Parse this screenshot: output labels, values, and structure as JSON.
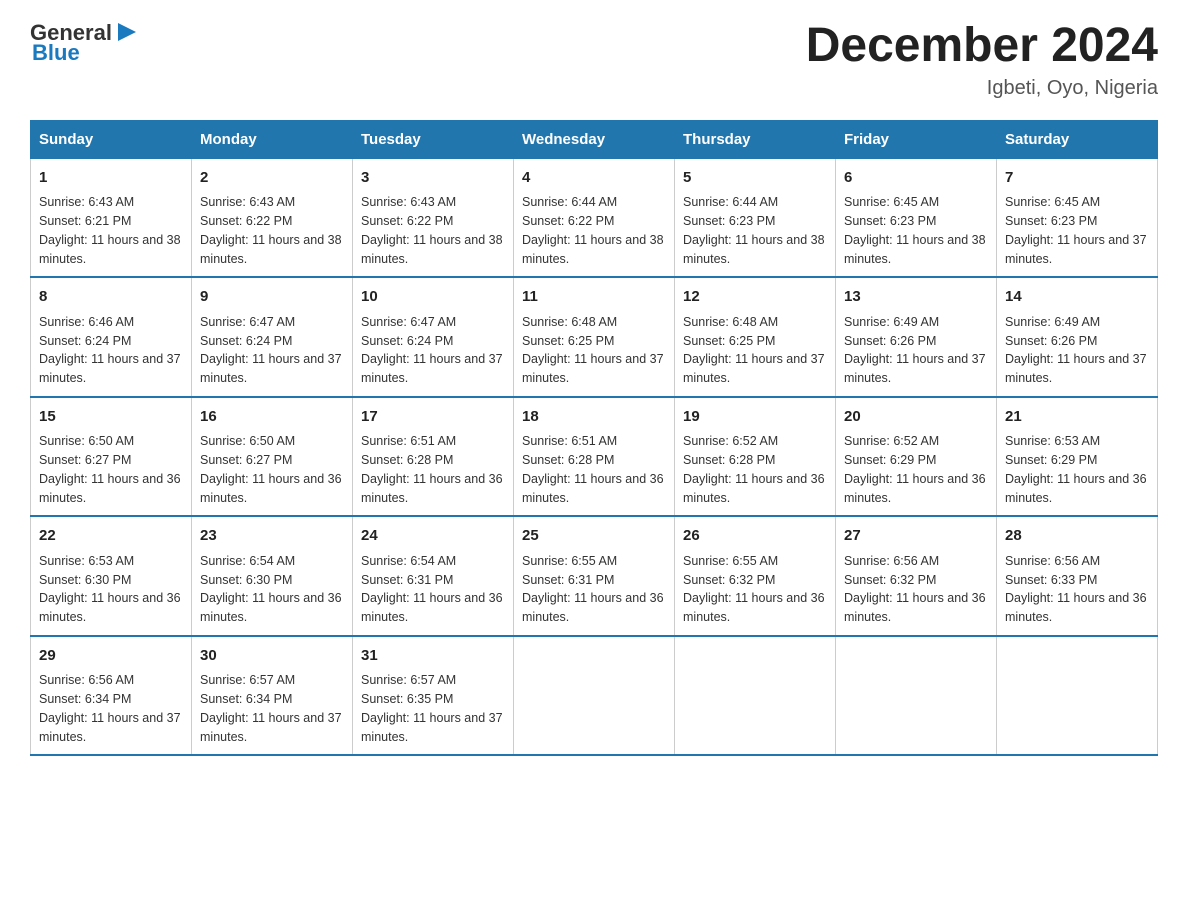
{
  "logo": {
    "general": "General",
    "arrow": "▶",
    "blue": "Blue"
  },
  "title": "December 2024",
  "location": "Igbeti, Oyo, Nigeria",
  "days_of_week": [
    "Sunday",
    "Monday",
    "Tuesday",
    "Wednesday",
    "Thursday",
    "Friday",
    "Saturday"
  ],
  "weeks": [
    [
      {
        "day": "1",
        "sunrise": "6:43 AM",
        "sunset": "6:21 PM",
        "daylight": "11 hours and 38 minutes."
      },
      {
        "day": "2",
        "sunrise": "6:43 AM",
        "sunset": "6:22 PM",
        "daylight": "11 hours and 38 minutes."
      },
      {
        "day": "3",
        "sunrise": "6:43 AM",
        "sunset": "6:22 PM",
        "daylight": "11 hours and 38 minutes."
      },
      {
        "day": "4",
        "sunrise": "6:44 AM",
        "sunset": "6:22 PM",
        "daylight": "11 hours and 38 minutes."
      },
      {
        "day": "5",
        "sunrise": "6:44 AM",
        "sunset": "6:23 PM",
        "daylight": "11 hours and 38 minutes."
      },
      {
        "day": "6",
        "sunrise": "6:45 AM",
        "sunset": "6:23 PM",
        "daylight": "11 hours and 38 minutes."
      },
      {
        "day": "7",
        "sunrise": "6:45 AM",
        "sunset": "6:23 PM",
        "daylight": "11 hours and 37 minutes."
      }
    ],
    [
      {
        "day": "8",
        "sunrise": "6:46 AM",
        "sunset": "6:24 PM",
        "daylight": "11 hours and 37 minutes."
      },
      {
        "day": "9",
        "sunrise": "6:47 AM",
        "sunset": "6:24 PM",
        "daylight": "11 hours and 37 minutes."
      },
      {
        "day": "10",
        "sunrise": "6:47 AM",
        "sunset": "6:24 PM",
        "daylight": "11 hours and 37 minutes."
      },
      {
        "day": "11",
        "sunrise": "6:48 AM",
        "sunset": "6:25 PM",
        "daylight": "11 hours and 37 minutes."
      },
      {
        "day": "12",
        "sunrise": "6:48 AM",
        "sunset": "6:25 PM",
        "daylight": "11 hours and 37 minutes."
      },
      {
        "day": "13",
        "sunrise": "6:49 AM",
        "sunset": "6:26 PM",
        "daylight": "11 hours and 37 minutes."
      },
      {
        "day": "14",
        "sunrise": "6:49 AM",
        "sunset": "6:26 PM",
        "daylight": "11 hours and 37 minutes."
      }
    ],
    [
      {
        "day": "15",
        "sunrise": "6:50 AM",
        "sunset": "6:27 PM",
        "daylight": "11 hours and 36 minutes."
      },
      {
        "day": "16",
        "sunrise": "6:50 AM",
        "sunset": "6:27 PM",
        "daylight": "11 hours and 36 minutes."
      },
      {
        "day": "17",
        "sunrise": "6:51 AM",
        "sunset": "6:28 PM",
        "daylight": "11 hours and 36 minutes."
      },
      {
        "day": "18",
        "sunrise": "6:51 AM",
        "sunset": "6:28 PM",
        "daylight": "11 hours and 36 minutes."
      },
      {
        "day": "19",
        "sunrise": "6:52 AM",
        "sunset": "6:28 PM",
        "daylight": "11 hours and 36 minutes."
      },
      {
        "day": "20",
        "sunrise": "6:52 AM",
        "sunset": "6:29 PM",
        "daylight": "11 hours and 36 minutes."
      },
      {
        "day": "21",
        "sunrise": "6:53 AM",
        "sunset": "6:29 PM",
        "daylight": "11 hours and 36 minutes."
      }
    ],
    [
      {
        "day": "22",
        "sunrise": "6:53 AM",
        "sunset": "6:30 PM",
        "daylight": "11 hours and 36 minutes."
      },
      {
        "day": "23",
        "sunrise": "6:54 AM",
        "sunset": "6:30 PM",
        "daylight": "11 hours and 36 minutes."
      },
      {
        "day": "24",
        "sunrise": "6:54 AM",
        "sunset": "6:31 PM",
        "daylight": "11 hours and 36 minutes."
      },
      {
        "day": "25",
        "sunrise": "6:55 AM",
        "sunset": "6:31 PM",
        "daylight": "11 hours and 36 minutes."
      },
      {
        "day": "26",
        "sunrise": "6:55 AM",
        "sunset": "6:32 PM",
        "daylight": "11 hours and 36 minutes."
      },
      {
        "day": "27",
        "sunrise": "6:56 AM",
        "sunset": "6:32 PM",
        "daylight": "11 hours and 36 minutes."
      },
      {
        "day": "28",
        "sunrise": "6:56 AM",
        "sunset": "6:33 PM",
        "daylight": "11 hours and 36 minutes."
      }
    ],
    [
      {
        "day": "29",
        "sunrise": "6:56 AM",
        "sunset": "6:34 PM",
        "daylight": "11 hours and 37 minutes."
      },
      {
        "day": "30",
        "sunrise": "6:57 AM",
        "sunset": "6:34 PM",
        "daylight": "11 hours and 37 minutes."
      },
      {
        "day": "31",
        "sunrise": "6:57 AM",
        "sunset": "6:35 PM",
        "daylight": "11 hours and 37 minutes."
      },
      null,
      null,
      null,
      null
    ]
  ]
}
